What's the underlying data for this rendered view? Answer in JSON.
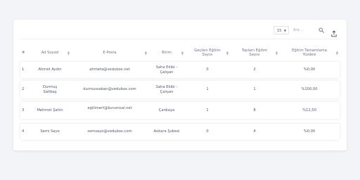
{
  "toolbar": {
    "page_size": "15",
    "search_placeholder": "Ara..."
  },
  "table": {
    "columns": [
      "#",
      "Ad Soyad",
      "E-Posta",
      "Birim",
      "Geçilen Eğitim Sayısı",
      "Toplam Eğitim Sayısı",
      "Eğitim Tamamlama Yüzdesi"
    ],
    "rows": [
      {
        "index": "1",
        "name": "Ahmet Aydın",
        "email": "ahmeta@vedubox.net",
        "unit": "Saha Ekibi - Çalışan",
        "passed": "0",
        "total": "2",
        "percent": "%0,00"
      },
      {
        "index": "2",
        "name": "Durmuş Saltbaş",
        "email": "durmussaban@vedubox.com",
        "unit": "Saha Ekibi - Çalışan",
        "passed": "1",
        "total": "1",
        "percent": "%100,00"
      },
      {
        "index": "3",
        "name": "Mehmet Şahin",
        "email": "egitimert@kurumsal.net",
        "unit": "Çankaya",
        "passed": "1",
        "total": "8",
        "percent": "%12,50"
      },
      {
        "index": "4",
        "name": "Semi Sayo",
        "email": "semsayo@vedubox.com",
        "unit": "Ankara Şubesi",
        "passed": "0",
        "total": "4",
        "percent": "%0,00"
      }
    ]
  },
  "colors": {
    "background": "#f3f4f8",
    "card": "#ffffff",
    "text": "#555b6e",
    "header_text": "#6e7487",
    "muted": "#a3a8b5"
  }
}
